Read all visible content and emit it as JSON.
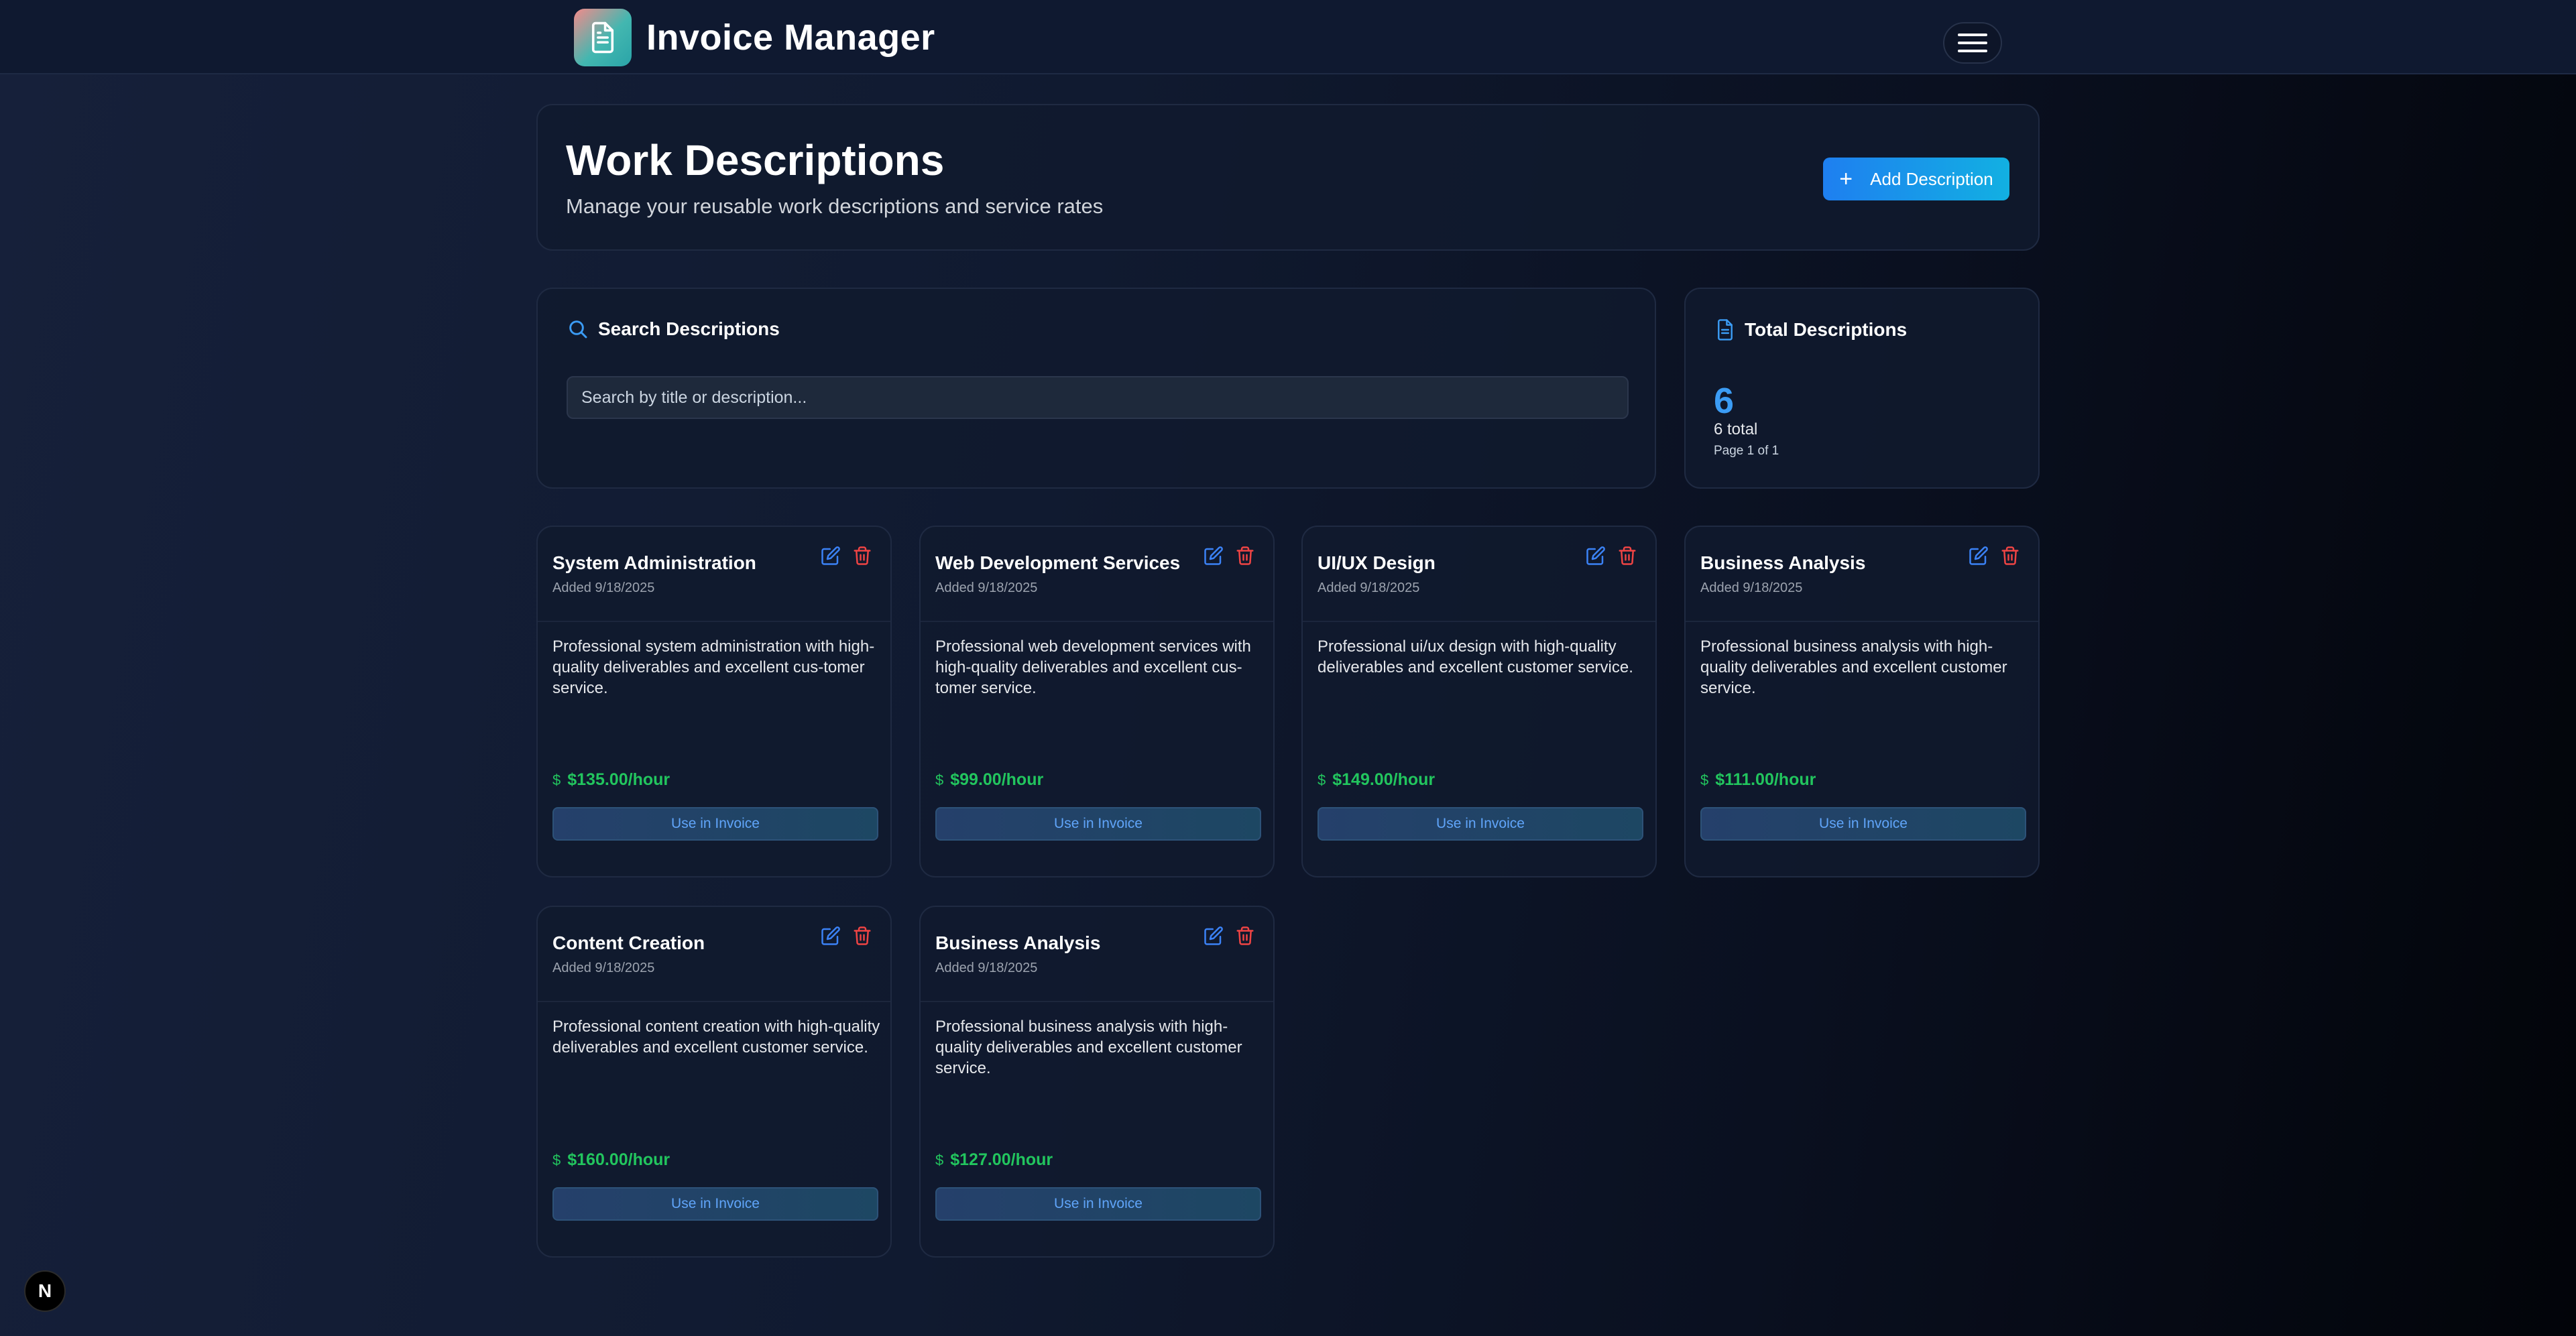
{
  "navbar": {
    "title": "Invoice Manager"
  },
  "header": {
    "title": "Work Descriptions",
    "subtitle": "Manage your reusable work descriptions and service rates",
    "add_button_label": "Add Description"
  },
  "search": {
    "section_label": "Search Descriptions",
    "placeholder": "Search by title or description..."
  },
  "summary": {
    "label": "Total Descriptions",
    "count": "6",
    "total_text": "6 total",
    "page_text": "Page 1 of 1"
  },
  "descriptions": [
    {
      "title": "System Administration",
      "added": "Added 9/18/2025",
      "text": "Professional system administration with high-quality deliverables and excellent cus-tomer service.",
      "rate": "$135.00/hour",
      "button": "Use in Invoice"
    },
    {
      "title": "Web Development Services",
      "added": "Added 9/18/2025",
      "text": "Professional web development services with high-quality deliverables and excellent cus-tomer service.",
      "rate": "$99.00/hour",
      "button": "Use in Invoice"
    },
    {
      "title": "UI/UX Design",
      "added": "Added 9/18/2025",
      "text": "Professional ui/ux design with high-quality deliverables and excellent customer service.",
      "rate": "$149.00/hour",
      "button": "Use in Invoice"
    },
    {
      "title": "Business Analysis",
      "added": "Added 9/18/2025",
      "text": "Professional business analysis with high-quality deliverables and excellent customer service.",
      "rate": "$111.00/hour",
      "button": "Use in Invoice"
    },
    {
      "title": "Content Creation",
      "added": "Added 9/18/2025",
      "text": "Professional content creation with high-quality deliverables and excellent customer service.",
      "rate": "$160.00/hour",
      "button": "Use in Invoice"
    },
    {
      "title": "Business Analysis",
      "added": "Added 9/18/2025",
      "text": "Professional business analysis with high-quality deliverables and excellent customer service.",
      "rate": "$127.00/hour",
      "button": "Use in Invoice"
    }
  ],
  "dev_badge": "N",
  "colors": {
    "accent": "#3b9cf5",
    "rate_green": "#22c55e",
    "delete_red": "#ef4444",
    "brand_gradient_start": "#f48a8a",
    "brand_gradient_end": "#2aa4a8"
  },
  "icons": {
    "brand": "document-icon",
    "menu": "hamburger-icon",
    "search": "search-icon",
    "total": "document-icon",
    "edit": "edit-icon",
    "delete": "trash-icon",
    "rate": "dollar-icon"
  }
}
